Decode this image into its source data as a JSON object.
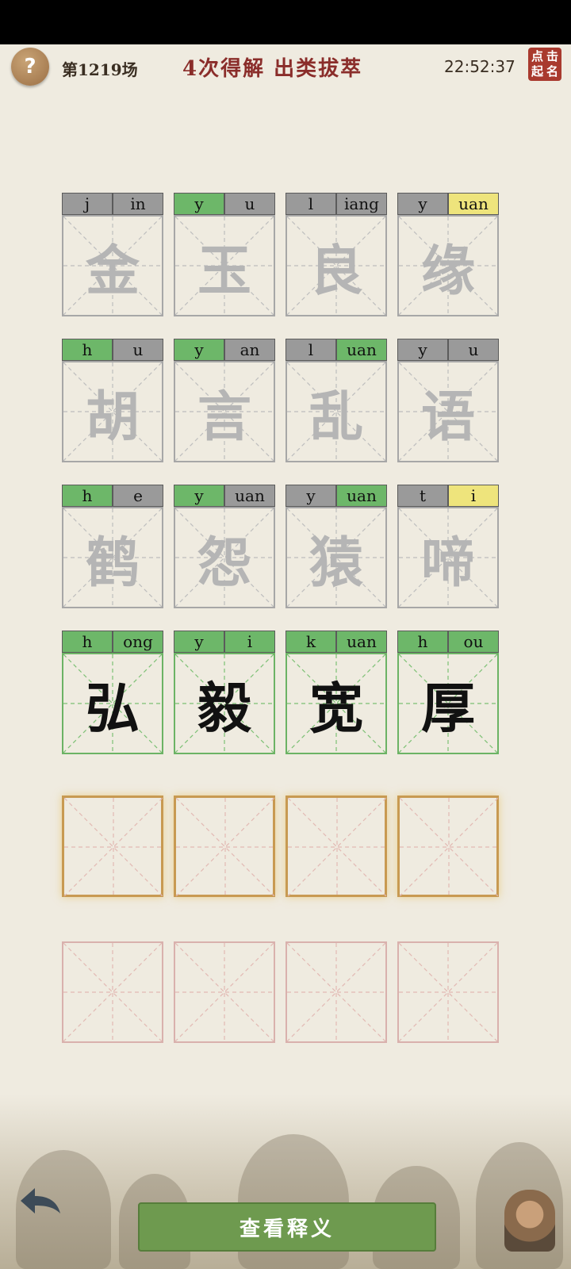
{
  "header": {
    "round": "第1219场",
    "title": "4次得解  出类拔萃",
    "clock": "22:52:37",
    "seal_text": [
      "点",
      "击",
      "起",
      "名"
    ]
  },
  "rows": [
    [
      {
        "char": "金",
        "initial": "j",
        "final": "in",
        "initial_state": "gray",
        "final_state": "gray",
        "state": "faded"
      },
      {
        "char": "玉",
        "initial": "y",
        "final": "u",
        "initial_state": "green",
        "final_state": "gray",
        "state": "faded"
      },
      {
        "char": "良",
        "initial": "l",
        "final": "iang",
        "initial_state": "gray",
        "final_state": "gray",
        "state": "faded"
      },
      {
        "char": "缘",
        "initial": "y",
        "final": "uan",
        "initial_state": "gray",
        "final_state": "yellow",
        "state": "faded"
      }
    ],
    [
      {
        "char": "胡",
        "initial": "h",
        "final": "u",
        "initial_state": "green",
        "final_state": "gray",
        "state": "faded"
      },
      {
        "char": "言",
        "initial": "y",
        "final": "an",
        "initial_state": "green",
        "final_state": "gray",
        "state": "faded"
      },
      {
        "char": "乱",
        "initial": "l",
        "final": "uan",
        "initial_state": "gray",
        "final_state": "green",
        "state": "faded"
      },
      {
        "char": "语",
        "initial": "y",
        "final": "u",
        "initial_state": "gray",
        "final_state": "gray",
        "state": "faded"
      }
    ],
    [
      {
        "char": "鹤",
        "initial": "h",
        "final": "e",
        "initial_state": "green",
        "final_state": "gray",
        "state": "faded"
      },
      {
        "char": "怨",
        "initial": "y",
        "final": "uan",
        "initial_state": "green",
        "final_state": "gray",
        "state": "faded"
      },
      {
        "char": "猿",
        "initial": "y",
        "final": "uan",
        "initial_state": "gray",
        "final_state": "green",
        "state": "faded"
      },
      {
        "char": "啼",
        "initial": "t",
        "final": "i",
        "initial_state": "gray",
        "final_state": "yellow",
        "state": "faded"
      }
    ],
    [
      {
        "char": "弘",
        "initial": "h",
        "final": "ong",
        "initial_state": "green",
        "final_state": "green",
        "state": "done"
      },
      {
        "char": "毅",
        "initial": "y",
        "final": "i",
        "initial_state": "green",
        "final_state": "green",
        "state": "done"
      },
      {
        "char": "宽",
        "initial": "k",
        "final": "uan",
        "initial_state": "green",
        "final_state": "green",
        "state": "done"
      },
      {
        "char": "厚",
        "initial": "h",
        "final": "ou",
        "initial_state": "green",
        "final_state": "green",
        "state": "done"
      }
    ]
  ],
  "active_row_count": 4,
  "empty_row_count": 4,
  "footer": {
    "view_button": "查看释义"
  },
  "colors": {
    "gray": "#9a9a9a",
    "green": "#6db769",
    "yellow": "#eee47c",
    "title": "#8a2d2a",
    "button": "#6e9a4f"
  }
}
